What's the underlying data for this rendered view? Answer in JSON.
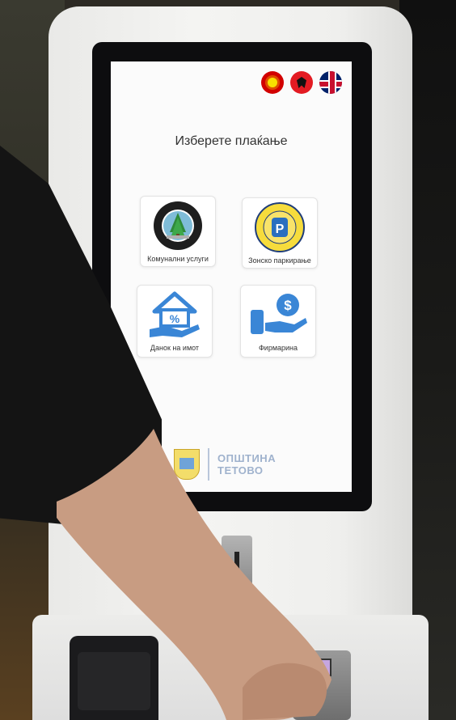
{
  "screen": {
    "title": "Изберете плаќање",
    "languages": [
      {
        "name": "macedonian-flag-icon"
      },
      {
        "name": "albanian-flag-icon"
      },
      {
        "name": "uk-flag-icon"
      }
    ],
    "options": [
      {
        "label": "Комунални услуги",
        "icon": "jkp-tetovo-logo-icon"
      },
      {
        "label": "Зонско паркирање",
        "icon": "parking-logo-icon"
      },
      {
        "label": "Данок на имот",
        "icon": "house-percent-hand-icon"
      },
      {
        "label": "Фирмарина",
        "icon": "dollar-hand-phone-icon"
      }
    ],
    "footer": {
      "line1": "ОПШТИНА",
      "line2": "ТЕТОВО"
    }
  },
  "colors": {
    "accent_blue": "#3a86d6",
    "flag_red": "#d20000",
    "logo_text": "#9fb2cd"
  }
}
